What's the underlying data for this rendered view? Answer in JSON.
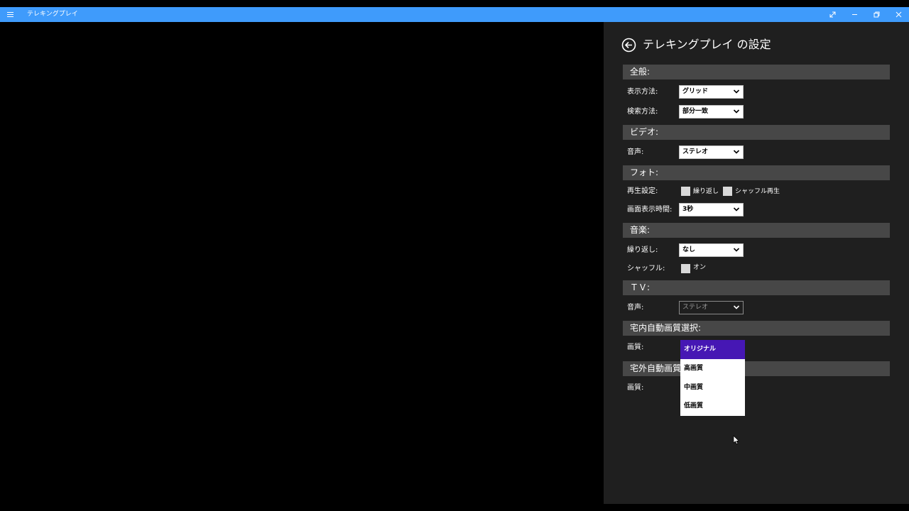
{
  "app": {
    "title": "テレキングプレイ"
  },
  "settings": {
    "title": "テレキングプレイ の設定",
    "sections": {
      "general": "全般:",
      "video": "ビデオ:",
      "photo": "フォト:",
      "music": "音楽:",
      "tv": "ＴＶ:",
      "home_quality": "宅内自動画質選択:",
      "away_quality": "宅外自動画質"
    },
    "general": {
      "display_label": "表示方法:",
      "display_value": "グリッド",
      "search_label": "検索方法:",
      "search_value": "部分一致"
    },
    "video": {
      "audio_label": "音声:",
      "audio_value": "ステレオ"
    },
    "photo": {
      "playback_label": "再生設定:",
      "repeat_label": "繰り返し",
      "shuffle_label": "シャッフル再生",
      "duration_label": "画面表示時間:",
      "duration_value": "3秒"
    },
    "music": {
      "repeat_label": "繰り返し:",
      "repeat_value": "なし",
      "shuffle_label": "シャッフル:",
      "shuffle_on_label": "オン"
    },
    "tv": {
      "audio_label": "音声:",
      "audio_value": "ステレオ"
    },
    "home_quality": {
      "quality_label": "画質:"
    },
    "away_quality": {
      "quality_label": "画質:"
    },
    "quality_dropdown": {
      "options": [
        "オリジナル",
        "高画質",
        "中画質",
        "低画質"
      ],
      "selected": "オリジナル"
    }
  },
  "icons": {
    "menu": "hamburger-icon",
    "back": "back-arrow-icon",
    "fullscreen": "fullscreen-icon",
    "minimize": "minimize-icon",
    "restore": "restore-icon",
    "close": "close-icon",
    "dropdown": "chevron-down-icon",
    "cursor": "mouse-cursor-icon"
  },
  "colors": {
    "titlebar": "#3f9bfb",
    "panel_bg": "#1f1f1f",
    "section_bg": "#474747",
    "selected_item": "#4617b4"
  }
}
